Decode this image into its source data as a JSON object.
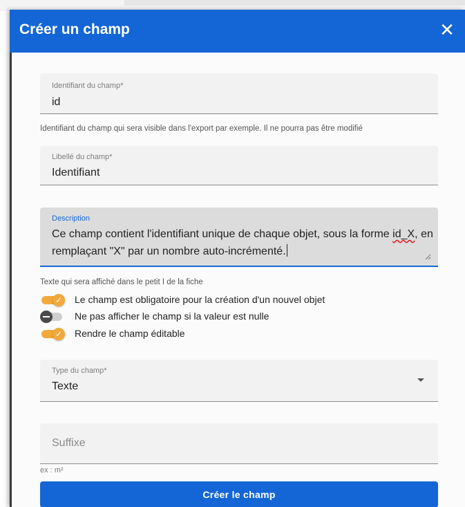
{
  "dialog": {
    "title": "Créer un champ",
    "close_icon": "close-icon",
    "close_glyph": "✕"
  },
  "fields": {
    "identifier": {
      "label": "Identifiant du champ*",
      "value": "id",
      "helper": "Identifiant du champ qui sera visible dans l'export par exemple. Il ne pourra pas être modifié"
    },
    "libelle": {
      "label": "Libellé du champ*",
      "value": "Identifiant"
    },
    "description": {
      "label": "Description",
      "value_part1": "Ce champ contient l'identifiant unique de chaque objet, sous la forme ",
      "value_misspelled": "id_X",
      "value_part2": ", en remplaçant \"X\" par un nombre auto-incrémenté.",
      "helper": "Texte qui sera affiché dans le petit I de la fiche"
    },
    "type": {
      "label": "Type du champ*",
      "value": "Texte",
      "arrow_icon": "dropdown-arrow-icon"
    },
    "suffix": {
      "placeholder": "Suffixe",
      "helper": "ex : m²"
    }
  },
  "toggles": [
    {
      "label": "Le champ est obligatoire pour la création d'un nouvel objet",
      "checked": true
    },
    {
      "label": "Ne pas afficher le champ si la valeur est nulle",
      "checked": false
    },
    {
      "label": "Rendre le champ éditable",
      "checked": true
    }
  ],
  "actions": {
    "submit_label": "Créer le champ"
  },
  "colors": {
    "primary": "#1466d6",
    "toggle_on": "#f2a93b",
    "toggle_off_knob": "#4a4a4a"
  }
}
